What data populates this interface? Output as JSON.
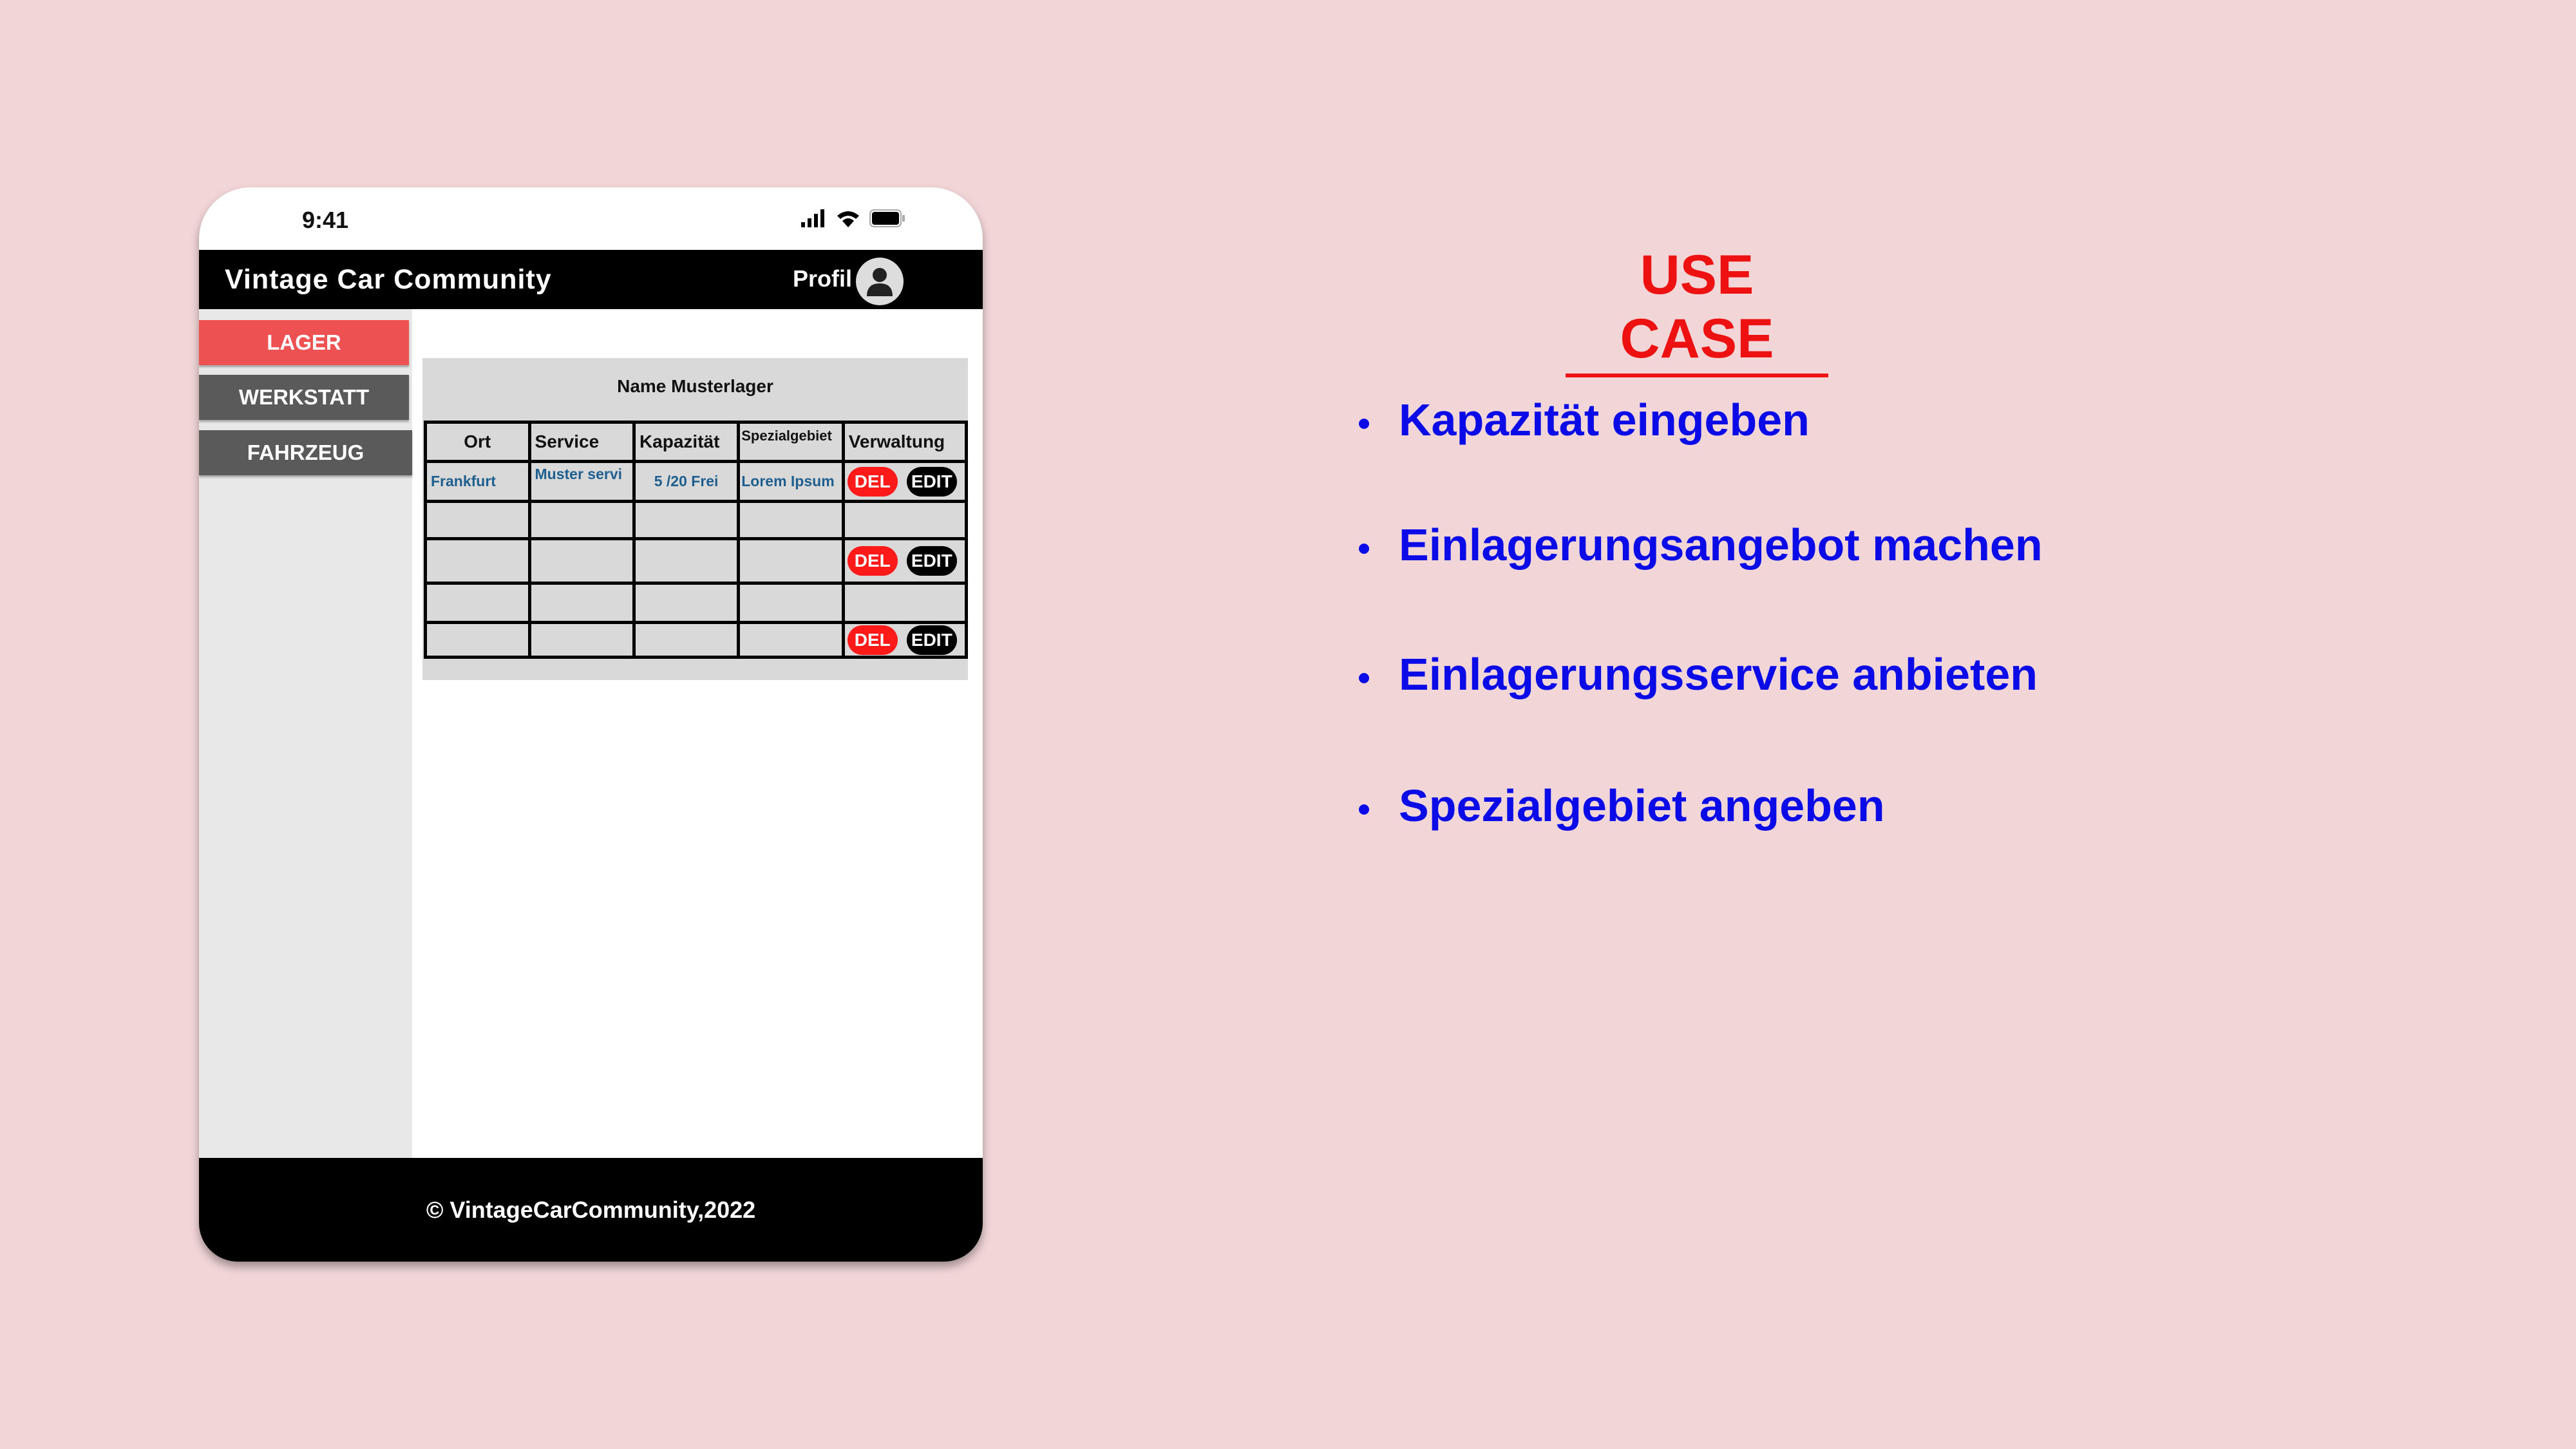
{
  "status_bar": {
    "time": "9:41"
  },
  "header": {
    "title": "Vintage Car Community",
    "profile_label": "Profil"
  },
  "sidebar": {
    "items": [
      {
        "label": "LAGER",
        "color": "#ee5152"
      },
      {
        "label": "WERKSTATT",
        "color": "#5a5a5a"
      },
      {
        "label": "FAHRZEUG",
        "color": "#5a5a5a"
      }
    ]
  },
  "panel": {
    "title": "Name Musterlager",
    "columns": [
      "Ort",
      "Service",
      "Kapazität",
      "Spezialgebiet",
      "Verwaltung"
    ],
    "rows": [
      [
        "Frankfurt",
        "Muster servi",
        "5 /20 Frei",
        "Lorem Ipsum"
      ],
      [
        "",
        "",
        "",
        ""
      ],
      [
        "",
        "",
        "",
        ""
      ],
      [
        "",
        "",
        "",
        ""
      ],
      [
        "",
        "",
        "",
        ""
      ]
    ],
    "del_label": "DEL",
    "edit_label": "EDIT"
  },
  "footer": {
    "text": "© VintageCarCommunity,2022"
  },
  "use_case": {
    "title": "USE CASE",
    "items": [
      "Kapazität eingeben",
      "Einlagerungsangebot machen",
      "Einlagerungsservice anbieten",
      "Spezialgebiet angeben"
    ]
  }
}
